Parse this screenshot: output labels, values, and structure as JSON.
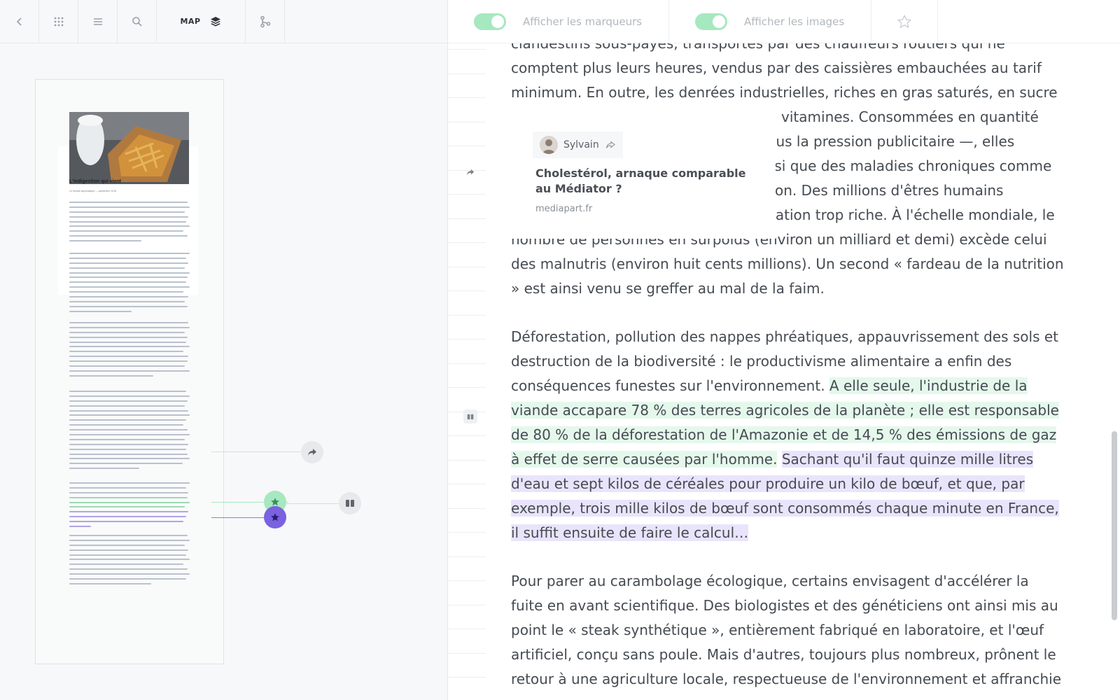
{
  "left_toolbar": {
    "map_label": "MAP",
    "icons": [
      "back-icon",
      "apps-grid-icon",
      "menu-icon",
      "search-icon",
      "layers-icon",
      "tree-branch-icon"
    ]
  },
  "thumbnail": {
    "title": "L'indigestion qui vient",
    "subtitle": "Le Monde diplomatique — septembre 2018"
  },
  "right_toolbar": {
    "toggle_markers_label": "Afficher les marqueurs",
    "toggle_markers_on": true,
    "toggle_images_label": "Afficher les images",
    "toggle_images_on": true,
    "star_icon": "star-outline-icon"
  },
  "popup": {
    "author": "Sylvain",
    "title": "Cholestérol, arnaque comparable au Médiator ?",
    "source": "mediapart.fr"
  },
  "article": {
    "p1": "clandestins sous-payés, transportés par des chauffeurs routiers qui ne comptent plus leurs heures, vendus par des caissières embauchées au tarif minimum. En outre, les denrées industrielles, riches en gras saturés, en sucre et en sel, sont pauvres en fibres et en vitamines. Consommées en quantité excessive — souvent dès l'enfance sous la pression publicitaire —, elles favorisent le surpoids et l'obésité, ainsi que des maladies chroniques comme le cholestérol, le diabète, l'hypertension. Des millions d'êtres humains meurent chaque année d'une alimentation trop riche. À l'échelle mondiale, le nombre de personnes en surpoids (environ un milliard et demi) excède celui des malnutris (environ huit cents millions). Un second « fardeau de la nutrition » est ainsi venu se greffer au mal de la faim.",
    "p2_plain": "Déforestation, pollution des nappes phréatiques, appauvrissement des sols et destruction de la biodiversité : le productivisme alimentaire a enfin des conséquences funestes sur l'environnement. ",
    "p2_green": "A elle seule, l'industrie de la viande accapare 78 % des terres agricoles de la planète ; elle est responsable de 80 % de la déforestation de l'Amazonie et de 14,5 % des émissions de gaz à effet de serre causées par l'homme.",
    "p2_purple": "Sachant qu'il faut quinze mille litres d'eau et sept kilos de céréales pour produire un kilo de bœuf, et que, par exemple, trois mille kilos de bœuf sont consommés chaque minute en France, il suffit ensuite de faire le calcul…",
    "p3": "Pour parer au carambolage écologique, certains envisagent d'accélérer la fuite en avant scientifique. Des biologistes et des généticiens ont ainsi mis au point le « steak synthétique », entièrement fabriqué en laboratoire, et l'œuf artificiel, conçu sans poule. Mais d'autres, toujours plus nombreux, prônent le retour à une agriculture locale, respectueuse de l'environnement et affranchie"
  },
  "colors": {
    "highlight_green": "#e5f8ec",
    "highlight_purple": "#e9e4fb",
    "marker_green": "#a6e8c0",
    "marker_purple": "#7a62e0",
    "toggle_on": "#a6e8c0"
  }
}
